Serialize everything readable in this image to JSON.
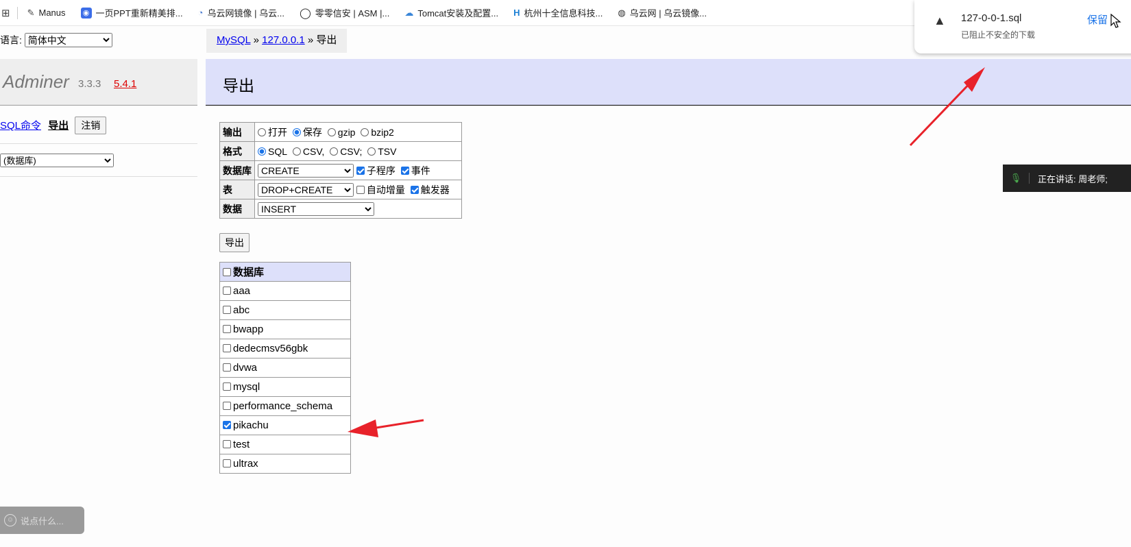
{
  "bookmarks": [
    {
      "label": "Manus",
      "icon": "manus-icon"
    },
    {
      "label": "一页PPT重新精美排...",
      "icon": "ppt-icon"
    },
    {
      "label": "乌云网镜像 | 乌云...",
      "icon": "wooyun-icon"
    },
    {
      "label": "零零信安 | ASM |...",
      "icon": "circle-icon"
    },
    {
      "label": "Tomcat安装及配置...",
      "icon": "cloud-icon"
    },
    {
      "label": "杭州十全信息科技...",
      "icon": "h-logo-icon"
    },
    {
      "label": "乌云网 | 乌云镜像...",
      "icon": "globe-icon"
    }
  ],
  "sidebar": {
    "lang_label": "语言:",
    "lang_value": "简体中文",
    "app_name": "Adminer",
    "version": "3.3.3",
    "new_version": "5.4.1",
    "sql_command": "SQL命令",
    "export_link": "导出",
    "logout": "注销",
    "db_select": "(数据库)"
  },
  "breadcrumb": {
    "mysql": "MySQL",
    "sep1": " » ",
    "host": "127.0.0.1",
    "sep2": " » ",
    "current": "导出"
  },
  "heading": "导出",
  "options": {
    "output": {
      "label": "输出",
      "choices": [
        "打开",
        "保存",
        "gzip",
        "bzip2"
      ],
      "selected": "保存"
    },
    "format": {
      "label": "格式",
      "choices": [
        "SQL",
        "CSV,",
        "CSV;",
        "TSV"
      ],
      "selected": "SQL"
    },
    "database": {
      "label": "数据库",
      "select": "CREATE",
      "checks": [
        {
          "label": "子程序",
          "checked": true
        },
        {
          "label": "事件",
          "checked": true
        }
      ]
    },
    "table": {
      "label": "表",
      "select": "DROP+CREATE",
      "checks": [
        {
          "label": "自动增量",
          "checked": false
        },
        {
          "label": "触发器",
          "checked": true
        }
      ]
    },
    "data": {
      "label": "数据",
      "select": "INSERT"
    }
  },
  "export_button": "导出",
  "db_list": {
    "header": "数据库",
    "items": [
      {
        "name": "aaa",
        "checked": false
      },
      {
        "name": "abc",
        "checked": false
      },
      {
        "name": "bwapp",
        "checked": false
      },
      {
        "name": "dedecmsv56gbk",
        "checked": false
      },
      {
        "name": "dvwa",
        "checked": false
      },
      {
        "name": "mysql",
        "checked": false
      },
      {
        "name": "performance_schema",
        "checked": false
      },
      {
        "name": "pikachu",
        "checked": true
      },
      {
        "name": "test",
        "checked": false
      },
      {
        "name": "ultrax",
        "checked": false
      }
    ]
  },
  "download_popup": {
    "filename": "127-0-0-1.sql",
    "message": "已阻止不安全的下载",
    "keep": "保留"
  },
  "speaking": {
    "label": "正在讲话:",
    "name": "周老师;"
  },
  "chat": {
    "placeholder": "说点什么..."
  },
  "colors": {
    "accent": "#1a73e8",
    "annotation_arrow": "#e8222a",
    "heading_bg": "#dde0fa"
  }
}
